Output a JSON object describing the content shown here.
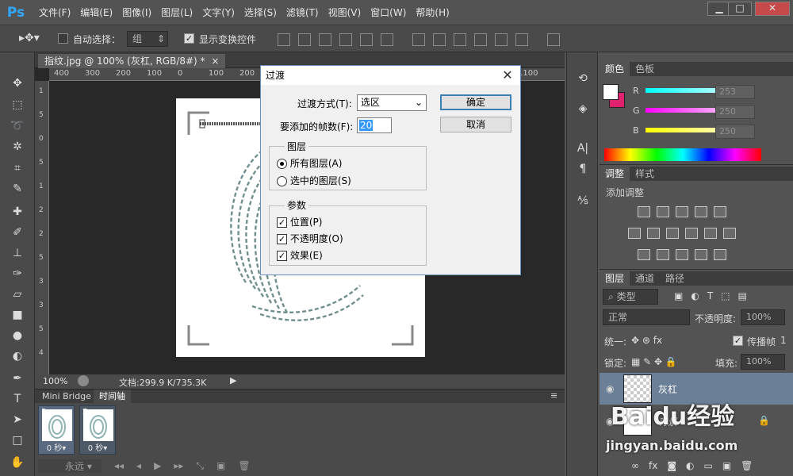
{
  "app": {
    "logo": "Ps"
  },
  "menu": [
    "文件(F)",
    "编辑(E)",
    "图像(I)",
    "图层(L)",
    "文字(Y)",
    "选择(S)",
    "滤镜(T)",
    "视图(V)",
    "窗口(W)",
    "帮助(H)"
  ],
  "window_controls": {
    "min": "▁",
    "max": "□",
    "close": "✕"
  },
  "options": {
    "auto_select_label": "自动选择：",
    "auto_select_value": "组",
    "show_transform_label": "显示变换控件"
  },
  "document": {
    "tab_title": "指纹.jpg @ 100% (灰杠, RGB/8#) *",
    "tab_close": "×",
    "ruler_ticks": [
      "400",
      "300",
      "200",
      "100",
      "0",
      "100",
      "200",
      "300",
      "400",
      "500",
      "600",
      "700",
      "800",
      "900",
      "1000",
      "1100"
    ],
    "ruler_v_ticks": [
      "1",
      "5",
      "0",
      "5",
      "1",
      "2",
      "2",
      "5",
      "3",
      "3",
      "5",
      "4"
    ],
    "zoom": "100%",
    "doc_size": "文档:299.9 K/735.3K"
  },
  "timeline": {
    "tabs": [
      "Mini Bridge",
      "时间轴"
    ],
    "frames": [
      {
        "num": "1",
        "duration": "0 秒▾"
      },
      {
        "num": "2",
        "duration": "0 秒▾"
      }
    ],
    "loop": "永远"
  },
  "colors": {
    "fg": "#ffffff",
    "bg": "#e0226e",
    "tabs": [
      "颜色",
      "色板"
    ],
    "r_label": "R",
    "g_label": "G",
    "b_label": "B",
    "r_value": "253",
    "g_value": "250",
    "b_value": "250"
  },
  "adjustments": {
    "tabs": [
      "调整",
      "样式"
    ],
    "title": "添加调整"
  },
  "layers": {
    "tabs": [
      "图层",
      "通道",
      "路径"
    ],
    "kind_filter": "类型",
    "blend_mode": "正常",
    "opacity_label": "不透明度:",
    "opacity_value": "100%",
    "unify_label": "统一:",
    "propagate_label": "传播帧",
    "propagate_value": "1",
    "lock_label": "锁定:",
    "fill_label": "填充:",
    "fill_value": "100%",
    "rows": [
      {
        "name": "灰杠"
      },
      {
        "name": "背景"
      }
    ]
  },
  "dialog": {
    "title": "过渡",
    "tween_label": "过渡方式(T):",
    "tween_value": "选区",
    "frames_label": "要添加的帧数(F):",
    "frames_value": "20",
    "ok": "确定",
    "cancel": "取消",
    "layers_group": "图层",
    "all_layers": "所有图层(A)",
    "selected_layers": "选中的图层(S)",
    "params_group": "参数",
    "position": "位置(P)",
    "opacity": "不透明度(O)",
    "effects": "效果(E)"
  },
  "watermark": {
    "brand": "Baidu经验",
    "url": "jingyan.baidu.com"
  }
}
